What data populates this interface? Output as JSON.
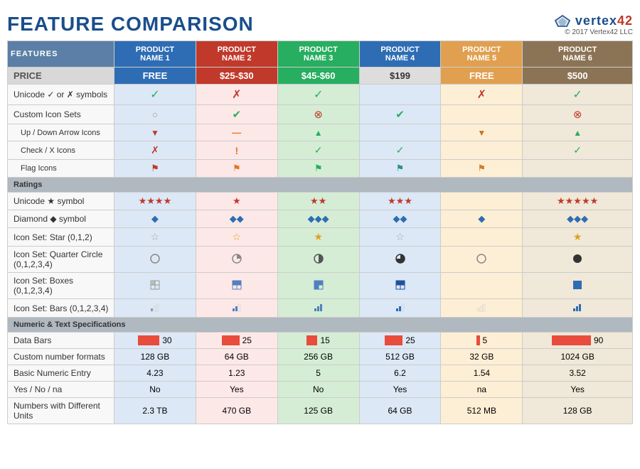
{
  "header": {
    "title": "FEATURE COMPARISON",
    "logo": "vertex42",
    "copyright": "© 2017 Vertex42 LLC"
  },
  "products": [
    {
      "label": "PRODUCT\nNAME 1",
      "class": "p1"
    },
    {
      "label": "PRODUCT\nNAME 2",
      "class": "p2"
    },
    {
      "label": "PRODUCT\nNAME 3",
      "class": "p3"
    },
    {
      "label": "PRODUCT\nNAME 4",
      "class": "p4"
    },
    {
      "label": "PRODUCT\nNAME 5",
      "class": "p5"
    },
    {
      "label": "PRODUCT\nNAME 6",
      "class": "p6"
    }
  ],
  "features_label": "FEATURES",
  "prices": [
    "FREE",
    "$25-$30",
    "$45-$60",
    "$199",
    "FREE",
    "$500"
  ],
  "sections": {
    "ratings": "Ratings",
    "numeric": "Numeric & Text Specifications"
  },
  "data_bars": {
    "label": "Data Bars",
    "values": [
      30,
      25,
      15,
      25,
      5,
      90
    ]
  },
  "rows": [
    {
      "label": "PRICE",
      "type": "price"
    },
    {
      "label": "Unicode ✓ or ✗ symbols",
      "type": "data",
      "cells": [
        "✓green",
        "✗red",
        "✓green",
        "",
        "✗red",
        "✓green"
      ]
    },
    {
      "label": "Custom Icon Sets",
      "type": "data",
      "cells": [
        "○empty",
        "●green-check",
        "⊗red",
        "●green-check",
        "",
        "⊗red"
      ]
    },
    {
      "label": "Up / Down Arrow Icons",
      "type": "sub",
      "cells": [
        "▼red",
        "—orange",
        "▲green",
        "",
        "▼orange",
        "▲green"
      ]
    },
    {
      "label": "Check / X Icons",
      "type": "sub",
      "cells": [
        "✗red",
        "!orange",
        "✓green",
        "✓green",
        "",
        "✓green"
      ]
    },
    {
      "label": "Flag Icons",
      "type": "sub",
      "cells": [
        "flag-red",
        "flag-orange",
        "flag-green",
        "flag-teal",
        "flag-orange",
        ""
      ]
    },
    {
      "label": "Ratings",
      "type": "section"
    },
    {
      "label": "Unicode ★ symbol",
      "type": "data",
      "cells": [
        "★★★★red",
        "★red",
        "★★red",
        "★★★red",
        "",
        "★★★★★red"
      ]
    },
    {
      "label": "Diamond ◆ symbol",
      "type": "data",
      "cells": [
        "◆blue",
        "◆◆blue",
        "◆◆◆blue",
        "◆◆blue",
        "◆blue",
        "◆◆◆blue"
      ]
    },
    {
      "label": "Icon Set: Star (0,1,2)",
      "type": "data",
      "cells": [
        "☆outline",
        "☆gold",
        "★gold",
        "☆outline",
        "",
        "★gold"
      ]
    },
    {
      "label": "Icon Set: Quarter Circle (0,1,2,3,4)",
      "type": "data",
      "cells": [
        "○empty",
        "quarter1",
        "quarter2",
        "quarter3",
        "○empty",
        "●full"
      ]
    },
    {
      "label": "Icon Set: Boxes (0,1,2,3,4)",
      "type": "data",
      "cells": [
        "box0",
        "box1",
        "box2",
        "box3",
        "",
        "box4"
      ]
    },
    {
      "label": "Icon Set: Bars (0,1,2,3,4)",
      "type": "data",
      "cells": [
        "bars0",
        "bars1",
        "bars2",
        "bars3",
        "bars0",
        "bars4"
      ]
    },
    {
      "label": "Numeric & Text Specifications",
      "type": "section"
    },
    {
      "label": "Data Bars",
      "type": "databars"
    },
    {
      "label": "Custom number formats",
      "type": "data",
      "cells": [
        "128 GB",
        "64 GB",
        "256 GB",
        "512 GB",
        "32 GB",
        "1024 GB"
      ]
    },
    {
      "label": "Basic Numeric Entry",
      "type": "data",
      "cells": [
        "4.23",
        "1.23",
        "5",
        "6.2",
        "1.54",
        "3.52"
      ]
    },
    {
      "label": "Yes / No / na",
      "type": "data",
      "cells": [
        "No",
        "Yes",
        "No",
        "Yes",
        "na",
        "Yes"
      ]
    },
    {
      "label": "Numbers with Different Units",
      "type": "data",
      "cells": [
        "2.3 TB",
        "470 GB",
        "125 GB",
        "64 GB",
        "512 MB",
        "128 GB"
      ]
    }
  ]
}
